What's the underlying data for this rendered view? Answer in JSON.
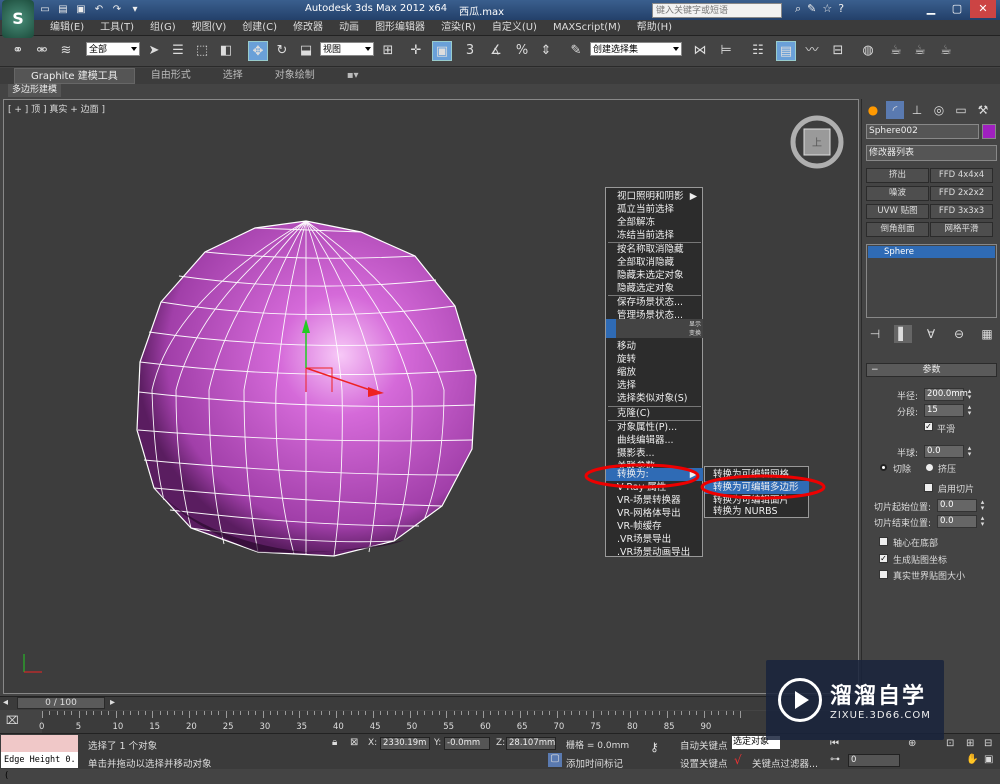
{
  "titlebar": {
    "app_icon": "S",
    "app_name": "Autodesk 3ds Max  2012 x64",
    "file_name": "西瓜.max",
    "search_placeholder": "键入关键字或短语",
    "qat_icons": [
      "new-icon",
      "open-icon",
      "save-icon",
      "undo-icon",
      "redo-icon",
      "dropdown-icon"
    ]
  },
  "menubar": [
    "编辑(E)",
    "工具(T)",
    "组(G)",
    "视图(V)",
    "创建(C)",
    "修改器",
    "动画",
    "图形编辑器",
    "渲染(R)",
    "自定义(U)",
    "MAXScript(M)",
    "帮助(H)"
  ],
  "toolbar": {
    "selection_filter": "全部",
    "ref_coord": "视图",
    "named_selection": "创建选择集",
    "snap_label": "3"
  },
  "ribbon": {
    "tabs": [
      "Graphite 建模工具",
      "自由形式",
      "选择",
      "对象绘制"
    ],
    "active_tab": 0,
    "sub_label": "多边形建模"
  },
  "viewport": {
    "label": "[ + ] 顶 ] 真实 + 边面 ]",
    "object_color": "#b44cc0",
    "viewcube_label": "上"
  },
  "context_menu": {
    "items": [
      {
        "label": "视口照明和阴影",
        "arrow": true
      },
      {
        "label": "孤立当前选择"
      },
      {
        "label": "全部解冻"
      },
      {
        "label": "冻结当前选择"
      },
      {
        "label": "按名称取消隐藏"
      },
      {
        "label": "全部取消隐藏"
      },
      {
        "label": "隐藏未选定对象"
      },
      {
        "label": "隐藏选定对象"
      },
      {
        "label": "保存场景状态..."
      },
      {
        "label": "管理场景状态..."
      },
      {
        "label": "显示"
      },
      {
        "label": "变换"
      },
      {
        "label": "移动"
      },
      {
        "label": "旋转"
      },
      {
        "label": "缩放"
      },
      {
        "label": "选择"
      },
      {
        "label": "选择类似对象(S)"
      },
      {
        "label": "克隆(C)"
      },
      {
        "label": "对象属性(P)..."
      },
      {
        "label": "曲线编辑器..."
      },
      {
        "label": "摄影表..."
      },
      {
        "label": "关联参数"
      },
      {
        "label": "转换为:",
        "highlighted": true
      },
      {
        "label": "V-Ray 属性"
      },
      {
        "label": "VR-场景转换器"
      },
      {
        "label": "VR-网格体导出"
      },
      {
        "label": "VR-帧缓存"
      },
      {
        "label": ".VR场景导出"
      },
      {
        "label": ".VR场景动画导出"
      }
    ],
    "submenu": [
      {
        "label": "转换为可编辑网格"
      },
      {
        "label": "转换为可编辑多边形",
        "highlighted": true
      },
      {
        "label": "转换为可编辑面片"
      },
      {
        "label": "转换为 NURBS"
      }
    ]
  },
  "command_panel": {
    "object_name": "Sphere002",
    "object_color": "#a020c0",
    "modifier_list": "修改器列表",
    "modifier_buttons": [
      "挤出",
      "FFD 4x4x4",
      "噪波",
      "FFD 2x2x2",
      "UVW 贴图",
      "FFD 3x3x3",
      "倒角剖面",
      "网格平滑"
    ],
    "stack_item": "Sphere",
    "rollout_title": "参数",
    "params": {
      "radius_label": "半径:",
      "radius": "200.0mm",
      "segments_label": "分段:",
      "segments": "15",
      "smooth_label": "平滑",
      "smooth": true,
      "hemisphere_label": "半球:",
      "hemisphere": "0.0",
      "chop_label": "切除",
      "squash_label": "挤压",
      "enable_slice_label": "启用切片",
      "slice_from_label": "切片起始位置:",
      "slice_from": "0.0",
      "slice_to_label": "切片结束位置:",
      "slice_to": "0.0",
      "base_to_pivot_label": "轴心在底部",
      "gen_mapping_label": "生成贴图坐标",
      "gen_mapping": true,
      "real_world_label": "真实世界贴图大小"
    }
  },
  "timeline": {
    "slider": "0 / 100",
    "ticks": [
      0,
      5,
      10,
      15,
      20,
      25,
      30,
      35,
      40,
      45,
      50,
      55,
      60,
      65,
      70,
      75,
      80,
      85,
      90
    ]
  },
  "status": {
    "maxscript_text": "Edge Height 0.(",
    "line1": "选择了 1 个对象",
    "line2": "单击并拖动以选择并移动对象",
    "x_label": "X:",
    "x": "2330.19m",
    "y_label": "Y:",
    "y": "-0.0mm",
    "z_label": "Z:",
    "z": "28.107mm",
    "grid": "栅格 = 0.0mm",
    "autokey": "自动关键点",
    "autokey_value": "选定对象",
    "setkey": "设置关键点",
    "keyfilter": "关键点过滤器...",
    "add_time_tag": "添加时间标记",
    "frame": "0"
  },
  "watermark": {
    "title": "溜溜自学",
    "url": "ZIXUE.3D66.COM"
  }
}
